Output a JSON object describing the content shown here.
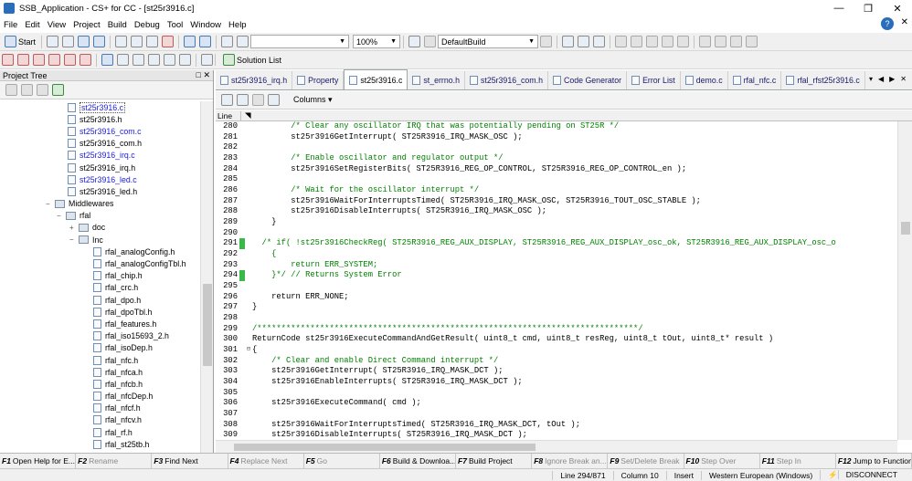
{
  "window": {
    "title": "SSB_Application - CS+ for CC - [st25r3916.c]"
  },
  "menu": [
    "File",
    "Edit",
    "View",
    "Project",
    "Build",
    "Debug",
    "Tool",
    "Window",
    "Help"
  ],
  "toolbar": {
    "start_label": "Start",
    "zoom": "100%",
    "build_config": "DefaultBuild",
    "solution_list": "Solution List"
  },
  "project_tree": {
    "title": "Project Tree",
    "pin": "✕",
    "items": [
      {
        "label": "st25r3916.c",
        "indent": 74,
        "kind": "file",
        "style": "sel"
      },
      {
        "label": "st25r3916.h",
        "indent": 74,
        "kind": "file",
        "style": ""
      },
      {
        "label": "st25r3916_com.c",
        "indent": 74,
        "kind": "file",
        "style": "lnk"
      },
      {
        "label": "st25r3916_com.h",
        "indent": 74,
        "kind": "file",
        "style": ""
      },
      {
        "label": "st25r3916_irq.c",
        "indent": 74,
        "kind": "file",
        "style": "lnk"
      },
      {
        "label": "st25r3916_irq.h",
        "indent": 74,
        "kind": "file",
        "style": ""
      },
      {
        "label": "st25r3916_led.c",
        "indent": 74,
        "kind": "file",
        "style": "lnk"
      },
      {
        "label": "st25r3916_led.h",
        "indent": 74,
        "kind": "file",
        "style": ""
      },
      {
        "label": "Middlewares",
        "indent": 50,
        "kind": "folder",
        "exp": "−"
      },
      {
        "label": "rfal",
        "indent": 62,
        "kind": "folder",
        "exp": "−"
      },
      {
        "label": "doc",
        "indent": 76,
        "kind": "folder",
        "exp": "+"
      },
      {
        "label": "Inc",
        "indent": 76,
        "kind": "folder",
        "exp": "−"
      },
      {
        "label": "rfal_analogConfig.h",
        "indent": 102,
        "kind": "file",
        "style": ""
      },
      {
        "label": "rfal_analogConfigTbl.h",
        "indent": 102,
        "kind": "file",
        "style": ""
      },
      {
        "label": "rfal_chip.h",
        "indent": 102,
        "kind": "file",
        "style": ""
      },
      {
        "label": "rfal_crc.h",
        "indent": 102,
        "kind": "file",
        "style": ""
      },
      {
        "label": "rfal_dpo.h",
        "indent": 102,
        "kind": "file",
        "style": ""
      },
      {
        "label": "rfal_dpoTbl.h",
        "indent": 102,
        "kind": "file",
        "style": ""
      },
      {
        "label": "rfal_features.h",
        "indent": 102,
        "kind": "file",
        "style": ""
      },
      {
        "label": "rfal_iso15693_2.h",
        "indent": 102,
        "kind": "file",
        "style": ""
      },
      {
        "label": "rfal_isoDep.h",
        "indent": 102,
        "kind": "file",
        "style": ""
      },
      {
        "label": "rfal_nfc.h",
        "indent": 102,
        "kind": "file",
        "style": ""
      },
      {
        "label": "rfal_nfca.h",
        "indent": 102,
        "kind": "file",
        "style": ""
      },
      {
        "label": "rfal_nfcb.h",
        "indent": 102,
        "kind": "file",
        "style": ""
      },
      {
        "label": "rfal_nfcDep.h",
        "indent": 102,
        "kind": "file",
        "style": ""
      },
      {
        "label": "rfal_nfcf.h",
        "indent": 102,
        "kind": "file",
        "style": ""
      },
      {
        "label": "rfal_nfcv.h",
        "indent": 102,
        "kind": "file",
        "style": ""
      },
      {
        "label": "rfal_rf.h",
        "indent": 102,
        "kind": "file",
        "style": ""
      },
      {
        "label": "rfal_st25tb.h",
        "indent": 102,
        "kind": "file",
        "style": ""
      }
    ]
  },
  "tabs": [
    {
      "label": "st25r3916_irq.h",
      "active": false
    },
    {
      "label": "Property",
      "active": false
    },
    {
      "label": "st25r3916.c",
      "active": true
    },
    {
      "label": "st_errno.h",
      "active": false
    },
    {
      "label": "st25r3916_com.h",
      "active": false
    },
    {
      "label": "Code Generator",
      "active": false
    },
    {
      "label": "Error List",
      "active": false
    },
    {
      "label": "demo.c",
      "active": false
    },
    {
      "label": "rfal_nfc.c",
      "active": false
    },
    {
      "label": "rfal_rfst25r3916.c",
      "active": false
    }
  ],
  "tab_nav": [
    "▾",
    "◀",
    "▶",
    "✕"
  ],
  "editor": {
    "columns_label": "Columns",
    "line_header": "Line",
    "lines": [
      {
        "n": "280",
        "t": "        /* Clear any oscillator IRQ that was potentially pending on ST25R */",
        "c": "cm",
        "m": false,
        "f": ""
      },
      {
        "n": "281",
        "t": "        st25r3916GetInterrupt( ST25R3916_IRQ_MASK_OSC );",
        "c": "cd",
        "m": false,
        "f": ""
      },
      {
        "n": "282",
        "t": "",
        "c": "cd",
        "m": false,
        "f": ""
      },
      {
        "n": "283",
        "t": "        /* Enable oscillator and regulator output */",
        "c": "cm",
        "m": false,
        "f": ""
      },
      {
        "n": "284",
        "t": "        st25r3916SetRegisterBits( ST25R3916_REG_OP_CONTROL, ST25R3916_REG_OP_CONTROL_en );",
        "c": "cd",
        "m": false,
        "f": ""
      },
      {
        "n": "285",
        "t": "",
        "c": "cd",
        "m": false,
        "f": ""
      },
      {
        "n": "286",
        "t": "        /* Wait for the oscillator interrupt */",
        "c": "cm",
        "m": false,
        "f": ""
      },
      {
        "n": "287",
        "t": "        st25r3916WaitForInterruptsTimed( ST25R3916_IRQ_MASK_OSC, ST25R3916_TOUT_OSC_STABLE );",
        "c": "cd",
        "m": false,
        "f": ""
      },
      {
        "n": "288",
        "t": "        st25r3916DisableInterrupts( ST25R3916_IRQ_MASK_OSC );",
        "c": "cd",
        "m": false,
        "f": ""
      },
      {
        "n": "289",
        "t": "    }",
        "c": "cd",
        "m": false,
        "f": ""
      },
      {
        "n": "290",
        "t": "",
        "c": "cd",
        "m": false,
        "f": ""
      },
      {
        "n": "291",
        "t": "  /* if( !st25r3916CheckReg( ST25R3916_REG_AUX_DISPLAY, ST25R3916_REG_AUX_DISPLAY_osc_ok, ST25R3916_REG_AUX_DISPLAY_osc_o",
        "c": "cm",
        "m": true,
        "f": ""
      },
      {
        "n": "292",
        "t": "    {",
        "c": "cm",
        "m": false,
        "f": ""
      },
      {
        "n": "293",
        "t": "        return ERR_SYSTEM;",
        "c": "cm",
        "m": false,
        "f": ""
      },
      {
        "n": "294",
        "t": "    }*/ // Returns System Error",
        "c": "cm",
        "m": true,
        "f": ""
      },
      {
        "n": "295",
        "t": "",
        "c": "cd",
        "m": false,
        "f": ""
      },
      {
        "n": "296",
        "t": "    return ERR_NONE;",
        "c": "cd",
        "m": false,
        "f": ""
      },
      {
        "n": "297",
        "t": "}",
        "c": "cd",
        "m": false,
        "f": ""
      },
      {
        "n": "298",
        "t": "",
        "c": "cd",
        "m": false,
        "f": ""
      },
      {
        "n": "299",
        "t": "/*******************************************************************************/",
        "c": "cm",
        "m": false,
        "f": ""
      },
      {
        "n": "300",
        "t": "ReturnCode st25r3916ExecuteCommandAndGetResult( uint8_t cmd, uint8_t resReg, uint8_t tOut, uint8_t* result )",
        "c": "cd",
        "m": false,
        "f": ""
      },
      {
        "n": "301",
        "t": "{",
        "c": "cd",
        "m": false,
        "f": "⊟"
      },
      {
        "n": "302",
        "t": "    /* Clear and enable Direct Command interrupt */",
        "c": "cm",
        "m": false,
        "f": ""
      },
      {
        "n": "303",
        "t": "    st25r3916GetInterrupt( ST25R3916_IRQ_MASK_DCT );",
        "c": "cd",
        "m": false,
        "f": ""
      },
      {
        "n": "304",
        "t": "    st25r3916EnableInterrupts( ST25R3916_IRQ_MASK_DCT );",
        "c": "cd",
        "m": false,
        "f": ""
      },
      {
        "n": "305",
        "t": "",
        "c": "cd",
        "m": false,
        "f": ""
      },
      {
        "n": "306",
        "t": "    st25r3916ExecuteCommand( cmd );",
        "c": "cd",
        "m": false,
        "f": ""
      },
      {
        "n": "307",
        "t": "",
        "c": "cd",
        "m": false,
        "f": ""
      },
      {
        "n": "308",
        "t": "    st25r3916WaitForInterruptsTimed( ST25R3916_IRQ_MASK_DCT, tOut );",
        "c": "cd",
        "m": false,
        "f": ""
      },
      {
        "n": "309",
        "t": "    st25r3916DisableInterrupts( ST25R3916_IRQ_MASK_DCT );",
        "c": "cd",
        "m": false,
        "f": ""
      }
    ]
  },
  "fkeys": [
    {
      "k": "F1",
      "l": "Open Help for E...",
      "d": false
    },
    {
      "k": "F2",
      "l": "Rename",
      "d": true
    },
    {
      "k": "F3",
      "l": "Find Next",
      "d": false
    },
    {
      "k": "F4",
      "l": "Replace Next",
      "d": true
    },
    {
      "k": "F5",
      "l": "Go",
      "d": true
    },
    {
      "k": "F6",
      "l": "Build & Downloa...",
      "d": false
    },
    {
      "k": "F7",
      "l": "Build Project",
      "d": false
    },
    {
      "k": "F8",
      "l": "Ignore Break an...",
      "d": true
    },
    {
      "k": "F9",
      "l": "Set/Delete Break",
      "d": true
    },
    {
      "k": "F10",
      "l": "Step Over",
      "d": true
    },
    {
      "k": "F11",
      "l": "Step In",
      "d": true
    },
    {
      "k": "F12",
      "l": "Jump to Function",
      "d": false
    }
  ],
  "status": {
    "line": "Line 294/871",
    "column": "Column 10",
    "mode": "Insert",
    "encoding": "Western European (Windows)",
    "connection": "DISCONNECT"
  },
  "colors": {
    "accent": "#2a6ebb",
    "comment": "#008000",
    "change_marker": "#3bb84a",
    "link": "#1a1ae0"
  }
}
